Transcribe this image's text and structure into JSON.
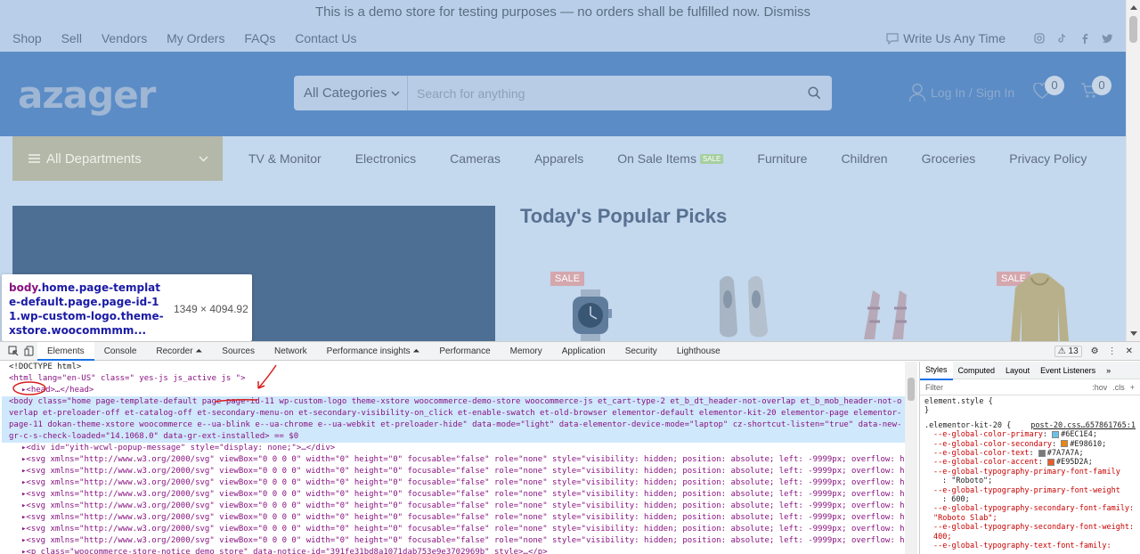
{
  "site": {
    "notice": "This is a demo store for testing purposes — no orders shall be fulfilled now. Dismiss",
    "top_links": [
      "Shop",
      "Sell",
      "Vendors",
      "My Orders",
      "FAQs",
      "Contact Us"
    ],
    "write_us": "Write Us Any Time",
    "logo": "azager",
    "search_category": "All Categories",
    "search_placeholder": "Search for anything",
    "login": "Log In / Sign In",
    "wishlist_count": "0",
    "cart_count": "0",
    "all_departments": "All Departments",
    "nav": [
      "TV & Monitor",
      "Electronics",
      "Cameras",
      "Apparels",
      "On Sale Items",
      "Furniture",
      "Children",
      "Groceries",
      "Privacy Policy"
    ],
    "sale_tag": "SALE",
    "popular_title": "Today's Popular Picks",
    "sale_badge": "SALE"
  },
  "tooltip": {
    "tag": "body",
    "selector": ".home.page-template-default.page.page-id-11.wp-custom-logo.theme-xstore.woocommmm...",
    "dimensions": "1349 × 4094.92"
  },
  "devtools": {
    "tabs": [
      "Elements",
      "Console",
      "Recorder ⏶",
      "Sources",
      "Network",
      "Performance insights ⏶",
      "Performance",
      "Memory",
      "Application",
      "Security",
      "Lighthouse"
    ],
    "warnings": "⚠ 13",
    "dom_lines": {
      "doctype": "<!DOCTYPE html>",
      "html_open": "<html lang=\"en-US\" class=\" yes-js js_active js \">",
      "head": "▸<head>…</head>",
      "body_selected": "<body class=\"home page-template-default page page-id-11 wp-custom-logo theme-xstore woocommerce-demo-store woocommerce-js et_cart-type-2 et_b_dt_header-not-overlap et_b_mob_header-not-overlap et-preloader-off et-catalog-off et-secondary-menu-on et-secondary-visibility-on_click et-enable-swatch et-old-browser elementor-default elementor-kit-20 elementor-page elementor-page-11 dokan-theme-xstore woocommerce e--ua-blink e--ua-chrome e--ua-webkit et-preloader-hide\" data-mode=\"light\" data-elementor-device-mode=\"laptop\" cz-shortcut-listen=\"true\" data-new-gr-c-s-check-loaded=\"14.1068.0\" data-gr-ext-installed> == $0",
      "div_popup": "▸<div id=\"yith-wcwl-popup-message\" style=\"display: none;\">…</div>",
      "svg_line": "▸<svg xmlns=\"http://www.w3.org/2000/svg\" viewBox=\"0 0 0 0\" width=\"0\" height=\"0\" focusable=\"false\" role=\"none\" style=\"visibility: hidden; position: absolute; left: -9999px; overflow: hidden;\">…</svg>",
      "p_notice": "▸<p class=\"woocommerce-store-notice demo_store\" data-notice-id=\"391fe31bd8a1071dab753e9e3702969b\" style>…</p>"
    },
    "styles_tabs": [
      "Styles",
      "Computed",
      "Layout",
      "Event Listeners"
    ],
    "filter": "Filter",
    "hov": ":hov",
    "cls": ".cls",
    "rules": {
      "element_style": "element.style {",
      "close": "}",
      "kit_selector": ".elementor-kit-20 {",
      "kit_source": "post-20.css…657861765:1",
      "vars": [
        {
          "name": "--e-global-color-primary",
          "value": "#6EC1E4",
          "color": "#6EC1E4"
        },
        {
          "name": "--e-global-color-secondary",
          "value": "#E98610",
          "color": "#E98610"
        },
        {
          "name": "--e-global-color-text",
          "value": "#7A7A7A",
          "color": "#7A7A7A"
        },
        {
          "name": "--e-global-color-accent",
          "value": "#E95D2A",
          "color": "#E95D2A"
        }
      ],
      "typo1": "--e-global-typography-primary-font-family",
      "typo1v": ": \"Roboto\";",
      "typo2": "--e-global-typography-primary-font-weight",
      "typo2v": ": 600;",
      "typo3": "--e-global-typography-secondary-font-family: \"Roboto Slab\";",
      "typo4": "--e-global-typography-secondary-font-weight: 400;",
      "typo5": "--e-global-typography-text-font-family:"
    }
  }
}
